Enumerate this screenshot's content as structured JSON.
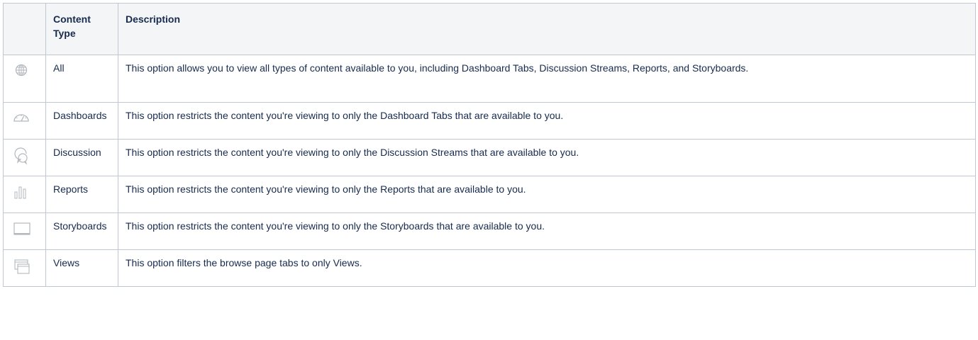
{
  "table": {
    "headers": {
      "icon": "",
      "content_type": "Content Type",
      "description": "Description"
    },
    "rows": [
      {
        "icon": "globe-icon",
        "type": "All",
        "description": "This option allows you to view all types of content available to you, including Dashboard Tabs, Discussion Streams, Reports, and Storyboards."
      },
      {
        "icon": "dashboard-gauge-icon",
        "type": "Dashboards",
        "description": "This option restricts the content you're viewing to only the Dashboard Tabs that are available to you."
      },
      {
        "icon": "discussion-icon",
        "type": "Discussion",
        "description": "This option restricts the content you're viewing to only the Discussion Streams that are available to you."
      },
      {
        "icon": "bar-chart-icon",
        "type": "Reports",
        "description": "This option restricts the content you're viewing to only the Reports that are available to you."
      },
      {
        "icon": "storyboard-icon",
        "type": "Storyboards",
        "description": "This option restricts the content you're viewing to only the Storyboards that are available to you."
      },
      {
        "icon": "views-icon",
        "type": "Views",
        "description": "This option filters the browse page tabs to only Views."
      }
    ]
  },
  "colors": {
    "border": "#c1c7d0",
    "header_bg": "#f4f5f7",
    "text": "#172b4d",
    "icon": "#b3b8be"
  }
}
